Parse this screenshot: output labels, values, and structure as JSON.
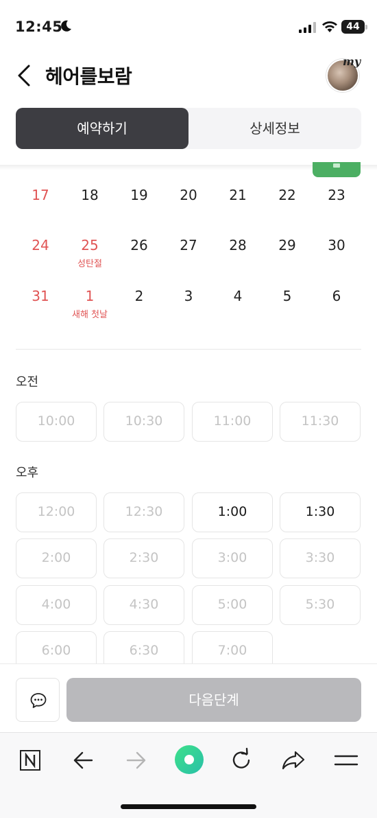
{
  "status_bar": {
    "time": "12:45",
    "battery": "44"
  },
  "header": {
    "title": "헤어를보람",
    "avatar_badge": "my"
  },
  "tabs": [
    {
      "label": "예약하기",
      "active": true
    },
    {
      "label": "상세정보",
      "active": false
    }
  ],
  "calendar": {
    "weeks": [
      [
        {
          "day": "17",
          "red": true
        },
        {
          "day": "18"
        },
        {
          "day": "19"
        },
        {
          "day": "20"
        },
        {
          "day": "21"
        },
        {
          "day": "22"
        },
        {
          "day": "23"
        }
      ],
      [
        {
          "day": "24",
          "red": true
        },
        {
          "day": "25",
          "red": true,
          "holiday": "성탄절"
        },
        {
          "day": "26"
        },
        {
          "day": "27"
        },
        {
          "day": "28"
        },
        {
          "day": "29"
        },
        {
          "day": "30"
        }
      ],
      [
        {
          "day": "31",
          "red": true
        },
        {
          "day": "1",
          "red": true,
          "holiday": "새해 첫날"
        },
        {
          "day": "2"
        },
        {
          "day": "3"
        },
        {
          "day": "4"
        },
        {
          "day": "5"
        },
        {
          "day": "6"
        }
      ]
    ]
  },
  "am": {
    "label": "오전",
    "slots": [
      {
        "time": "10:00",
        "available": false
      },
      {
        "time": "10:30",
        "available": false
      },
      {
        "time": "11:00",
        "available": false
      },
      {
        "time": "11:30",
        "available": false
      }
    ]
  },
  "pm": {
    "label": "오후",
    "slots": [
      {
        "time": "12:00",
        "available": false
      },
      {
        "time": "12:30",
        "available": false
      },
      {
        "time": "1:00",
        "available": true
      },
      {
        "time": "1:30",
        "available": true
      },
      {
        "time": "2:00",
        "available": false
      },
      {
        "time": "2:30",
        "available": false
      },
      {
        "time": "3:00",
        "available": false
      },
      {
        "time": "3:30",
        "available": false
      },
      {
        "time": "4:00",
        "available": false
      },
      {
        "time": "4:30",
        "available": false
      },
      {
        "time": "5:00",
        "available": false
      },
      {
        "time": "5:30",
        "available": false
      },
      {
        "time": "6:00",
        "available": false
      },
      {
        "time": "6:30",
        "available": false
      },
      {
        "time": "7:00",
        "available": false
      }
    ]
  },
  "actions": {
    "next_label": "다음단계",
    "chat_icon": "chat-bubble-icon"
  },
  "browser": {
    "icons": [
      "naver-home-icon",
      "back-arrow-icon",
      "forward-arrow-icon",
      "green-dot-icon",
      "reload-icon",
      "share-icon",
      "menu-icon"
    ]
  },
  "colors": {
    "holiday_red": "#e05454",
    "active_tab": "#3d3d42",
    "next_disabled": "#b9b9bc",
    "accent_green": "#4caf63"
  }
}
